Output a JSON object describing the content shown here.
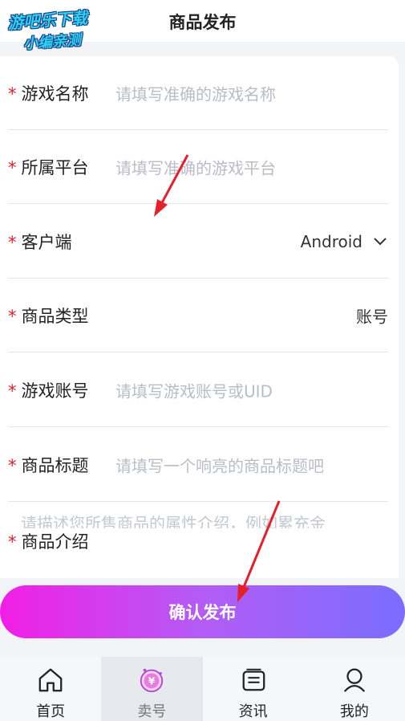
{
  "header": {
    "title": "商品发布",
    "watermark_line1": "游吧乐下载",
    "watermark_line2": "小编亲测"
  },
  "form": {
    "required_mark": "*",
    "rows": [
      {
        "label": "游戏名称",
        "placeholder": "请填写准确的游戏名称"
      },
      {
        "label": "所属平台",
        "placeholder": "请填写准确的游戏平台"
      },
      {
        "label": "客户端",
        "value": "Android"
      },
      {
        "label": "商品类型",
        "value": "账号"
      },
      {
        "label": "游戏账号",
        "placeholder": "请填写游戏账号或UID"
      },
      {
        "label": "商品标题",
        "placeholder": "请填写一个响亮的商品标题吧"
      }
    ],
    "intro_label": "商品介绍",
    "intro_placeholder": "请描述您所售商品的属性介绍，例如累充金"
  },
  "submit_label": "确认发布",
  "tabbar": {
    "items": [
      {
        "label": "首页",
        "icon": "home-icon"
      },
      {
        "label": "卖号",
        "icon": "sell-yuan-icon",
        "active": true
      },
      {
        "label": "资讯",
        "icon": "news-icon"
      },
      {
        "label": "我的",
        "icon": "user-icon"
      }
    ]
  },
  "colors": {
    "required": "#e11d2a",
    "gradient_start": "#f21ee6",
    "gradient_end": "#7a6dff",
    "annotation_arrow": "#e5202a"
  }
}
